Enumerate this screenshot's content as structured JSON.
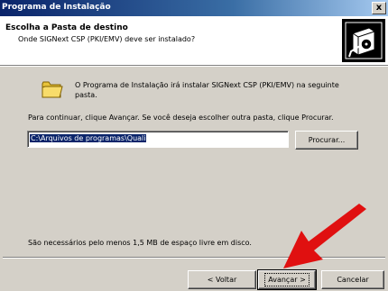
{
  "window": {
    "title": "Programa de Instalação",
    "close_glyph": "x"
  },
  "header": {
    "title": "Escolha a Pasta de destino",
    "subtitle": "Onde SIGNext CSP (PKI/EMV) deve ser instalado?",
    "logo_icon": "installer-icon"
  },
  "body": {
    "folder_icon": "folder-icon",
    "intro_text": "O Programa de Instalação irá instalar SIGNext CSP (PKI/EMV) na seguinte pasta.",
    "continue_text": "Para continuar, clique Avançar. Se você deseja escolher outra pasta, clique Procurar.",
    "path_value": "C:\\Arquivos de programas\\Quali",
    "browse_label": "Procurar...",
    "space_note": "São necessários pelo menos 1,5 MB de espaço livre em disco."
  },
  "footer": {
    "back_label": "< Voltar",
    "next_label": "Avançar >",
    "cancel_label": "Cancelar"
  },
  "annotation": {
    "arrow_color": "#e01010"
  }
}
